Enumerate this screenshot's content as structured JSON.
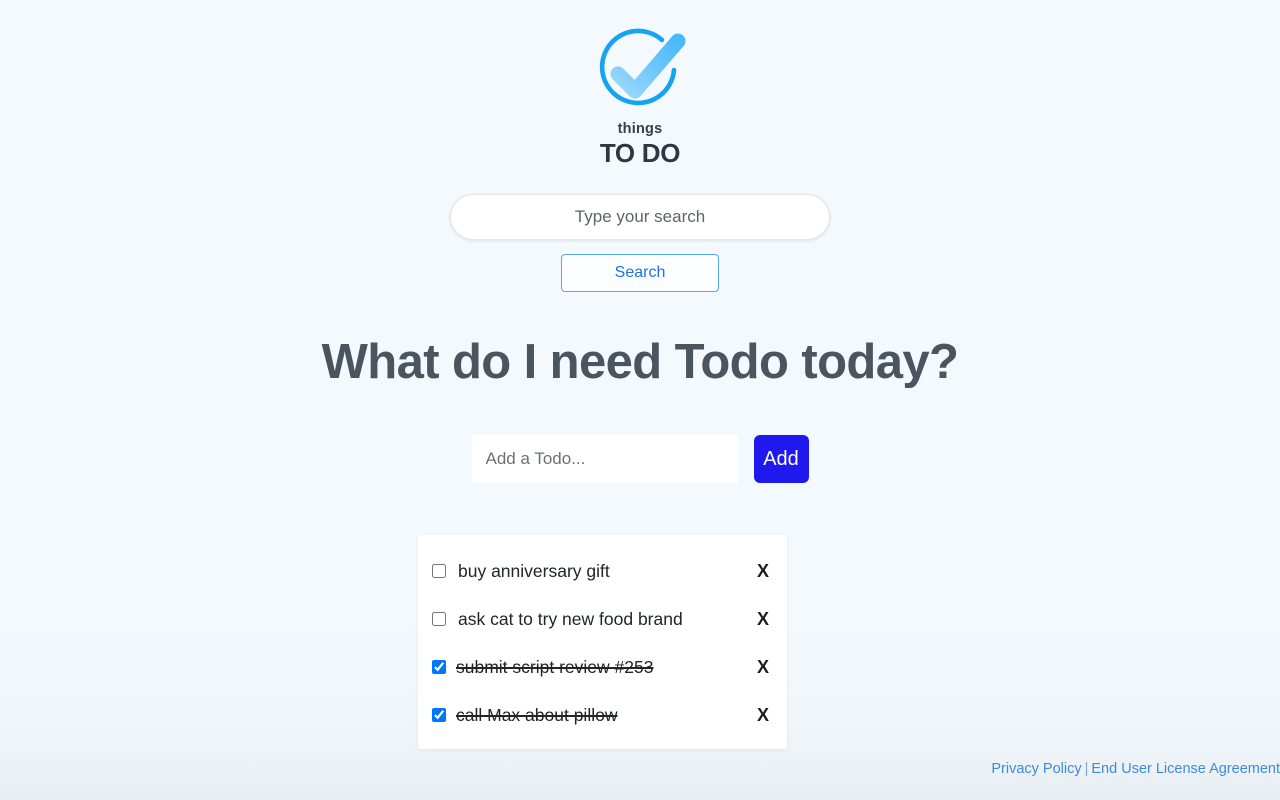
{
  "logo": {
    "icon": "circle-check-icon",
    "word_small": "things",
    "word_large": "TO DO",
    "ring_color": "#16a3f2",
    "check_color_light": "#8ed3fb",
    "check_color_dark": "#3fb6f7"
  },
  "search": {
    "placeholder": "Type your search",
    "value": "",
    "button_label": "Search",
    "button_color": "#1a73e8"
  },
  "main": {
    "headline": "What do I need Todo today?"
  },
  "add": {
    "placeholder": "Add a Todo...",
    "value": "",
    "button_label": "Add",
    "button_color": "#1f19ee"
  },
  "todos": [
    {
      "label": "buy anniversary gift",
      "done": false,
      "delete_label": "X"
    },
    {
      "label": "ask cat to try new food brand",
      "done": false,
      "delete_label": "X"
    },
    {
      "label": "submit script review #253",
      "done": true,
      "delete_label": "X"
    },
    {
      "label": "call Max about pillow",
      "done": true,
      "delete_label": "X"
    }
  ],
  "footer": {
    "privacy_label": "Privacy Policy",
    "separator": "|",
    "eula_label": "End User License Agreement",
    "link_color": "#3d8bdc"
  }
}
